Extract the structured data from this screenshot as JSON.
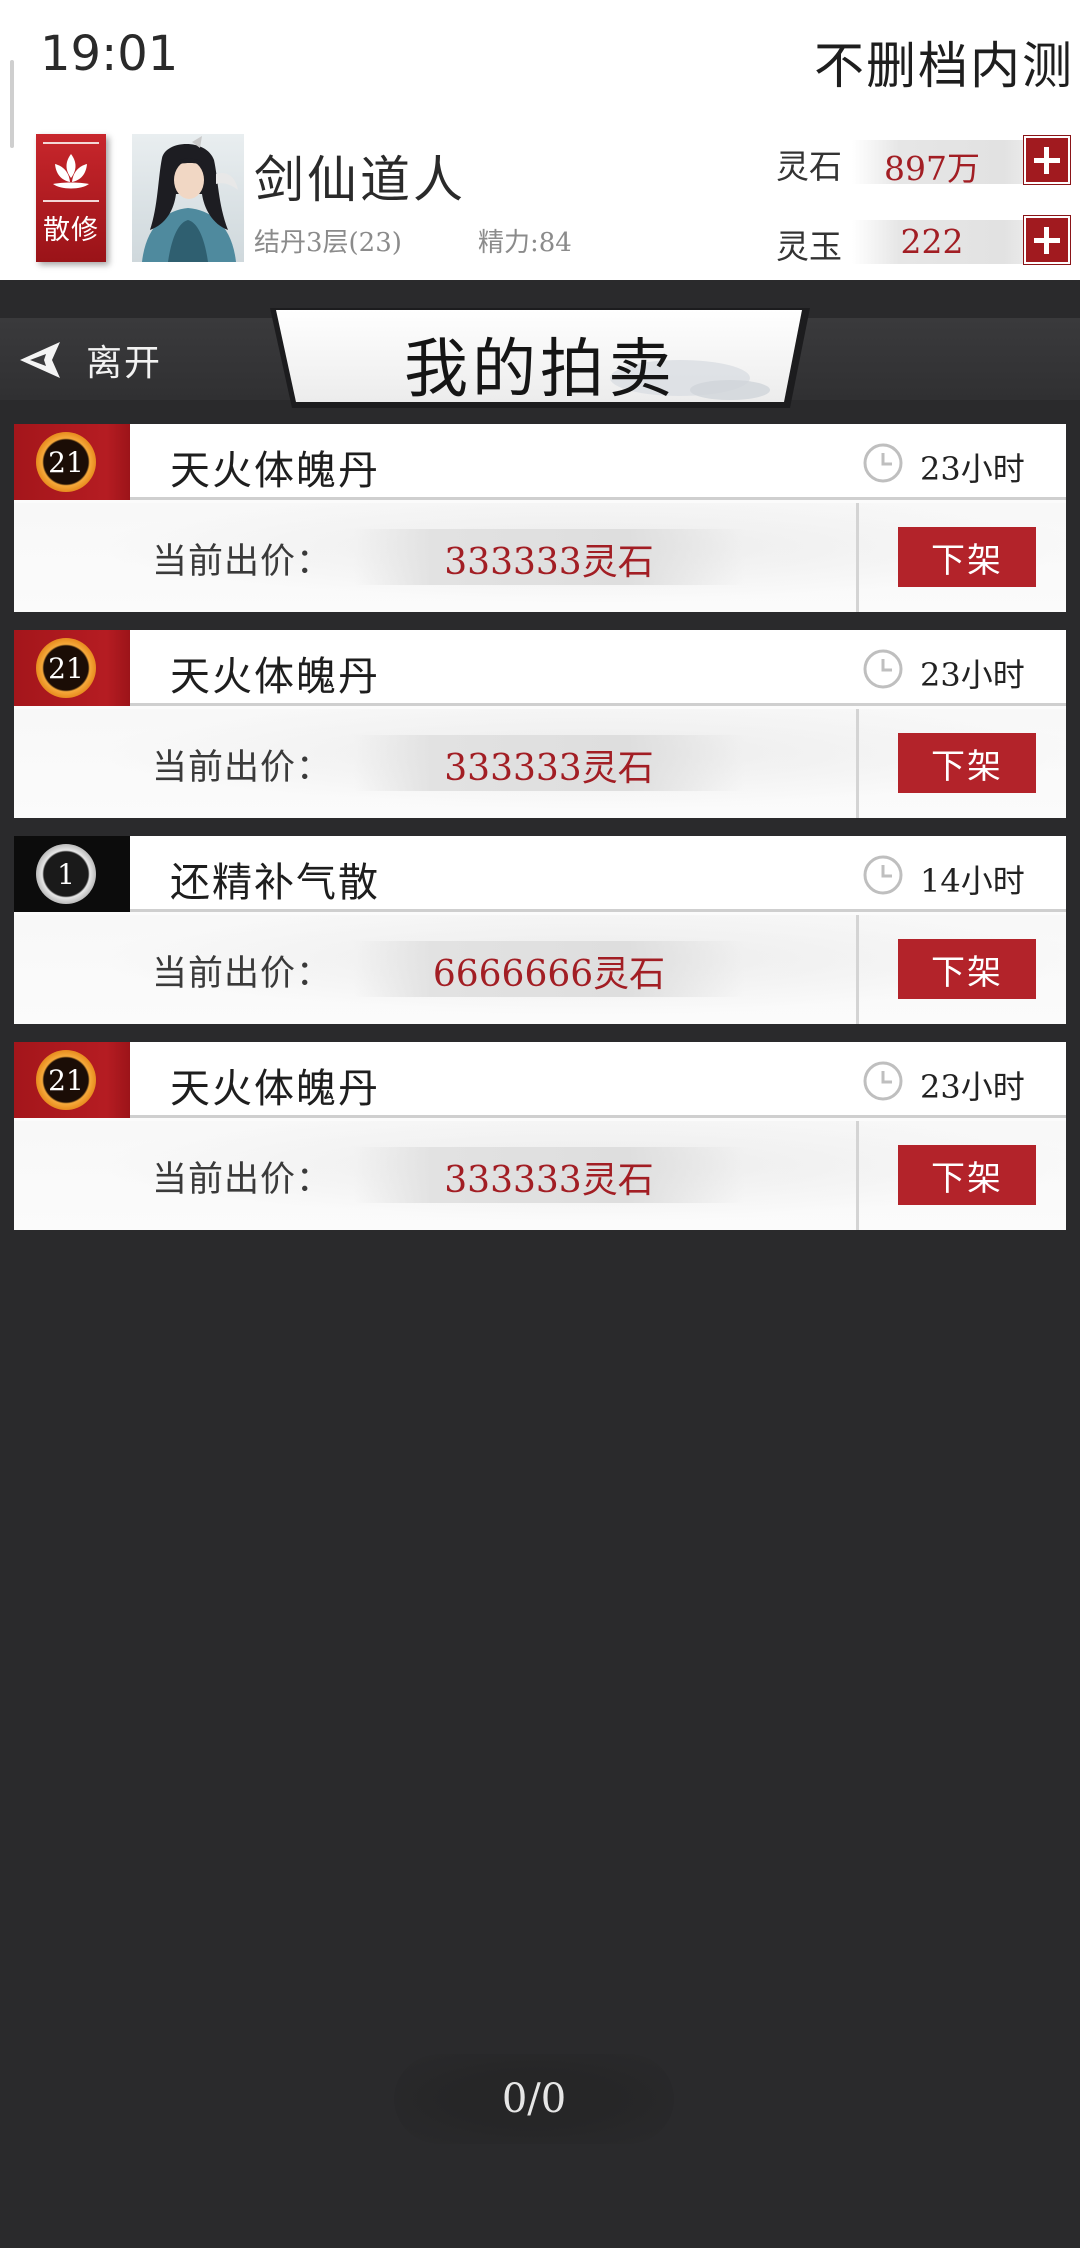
{
  "status": {
    "time": "19:01",
    "server": "不删档内测"
  },
  "player": {
    "sect_label": "散修",
    "name": "剑仙道人",
    "level": "结丹3层(23)",
    "stamina": "精力:84"
  },
  "currencies": [
    {
      "label": "灵石",
      "value": "897万",
      "icon": "plus-icon"
    },
    {
      "label": "灵玉",
      "value": "222",
      "icon": "plus-icon"
    }
  ],
  "nav": {
    "leave_label": "离开",
    "title": "我的拍卖"
  },
  "auctions": [
    {
      "level": "21",
      "badge": "gold",
      "name": "天火体魄丹",
      "time_left": "23小时",
      "price_label": "当前出价：",
      "price": "333333灵石",
      "action": "下架"
    },
    {
      "level": "21",
      "badge": "gold",
      "name": "天火体魄丹",
      "time_left": "23小时",
      "price_label": "当前出价：",
      "price": "333333灵石",
      "action": "下架"
    },
    {
      "level": "1",
      "badge": "silver",
      "name": "还精补气散",
      "time_left": "14小时",
      "price_label": "当前出价：",
      "price": "6666666灵石",
      "action": "下架"
    },
    {
      "level": "21",
      "badge": "gold",
      "name": "天火体魄丹",
      "time_left": "23小时",
      "price_label": "当前出价：",
      "price": "333333灵石",
      "action": "下架"
    }
  ],
  "pager": {
    "text": "0/0"
  },
  "colors": {
    "accent_red": "#b3232a",
    "price_red": "#a21e24",
    "background": "#2a2a2c"
  }
}
